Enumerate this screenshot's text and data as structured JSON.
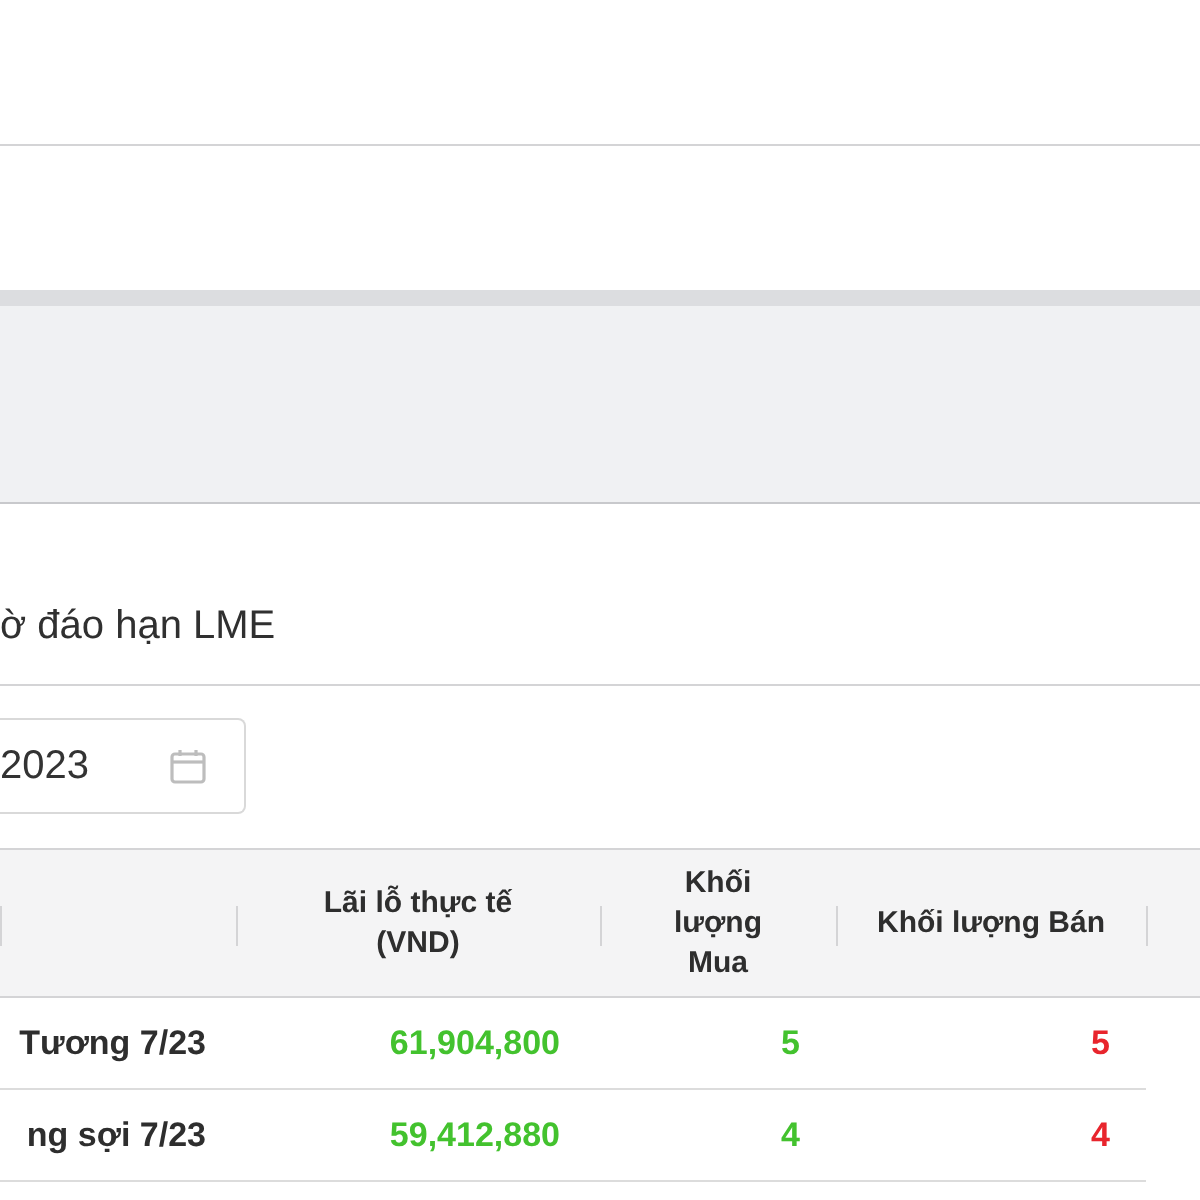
{
  "section_title": "ờ đáo hạn LME",
  "date_field": {
    "value": "2023"
  },
  "table": {
    "columns": [
      "Lãi lỗ thực tế (VND)",
      "Khối lượng Mua",
      "Khối lượng Bán"
    ],
    "rows": [
      {
        "contract": "Tương 7/23",
        "realized_pnl": "61,904,800",
        "buy_volume": "5",
        "sell_volume": "5"
      },
      {
        "contract": "ng sợi 7/23",
        "realized_pnl": "59,412,880",
        "buy_volume": "4",
        "sell_volume": "4"
      }
    ]
  }
}
